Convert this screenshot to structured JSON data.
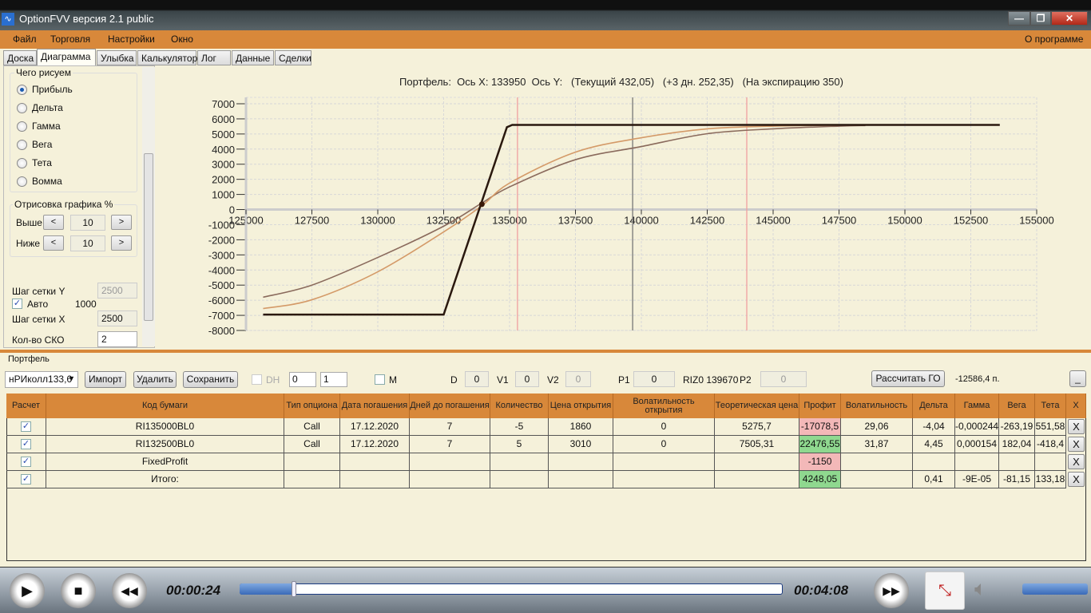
{
  "window": {
    "title": "OptionFVV версия 2.1 public",
    "minimize": "—",
    "restore": "❐",
    "close": "✕"
  },
  "menu": {
    "items": [
      "Файл",
      "Торговля",
      "Настройки",
      "Окно"
    ],
    "about": "О программе"
  },
  "tabs": [
    "Доска",
    "Диаграмма",
    "Улыбка",
    "Калькулятор",
    "Лог",
    "Данные",
    "Сделки"
  ],
  "active_tab": "Диаграмма",
  "left_panel": {
    "draw_group": "Чего рисуем",
    "options": [
      "Прибыль",
      "Дельта",
      "Гамма",
      "Вега",
      "Тета",
      "Вомма"
    ],
    "selected": "Прибыль",
    "render_group": "Отрисовка графика %",
    "above_label": "Выше",
    "above_value": "10",
    "below_label": "Ниже",
    "below_value": "10",
    "prev": "<",
    "next": ">",
    "grid_y_label": "Шаг сетки Y",
    "grid_y_value": "2500",
    "auto_label": "Авто",
    "auto_checked": true,
    "auto_value": "1000",
    "grid_x_label": "Шаг сетки X",
    "grid_x_value": "2500",
    "sko_label": "Кол-во СКО",
    "sko_value": "2"
  },
  "chart_header": "Портфель:  Ось X: 133950  Ось Y:   (Текущий 432,05)   (+3 дн. 252,35)   (На экспирацию 350)",
  "chart_data": {
    "type": "line",
    "xlim": [
      125000,
      155000
    ],
    "ylim": [
      -8000,
      7000
    ],
    "x_ticks": [
      125000,
      127500,
      130000,
      132500,
      135000,
      137500,
      140000,
      142500,
      145000,
      147500,
      150000,
      152500,
      155000
    ],
    "y_ticks": [
      7000,
      6000,
      5000,
      4000,
      3000,
      2000,
      1000,
      0,
      -1000,
      -2000,
      -3000,
      -4000,
      -5000,
      -6000,
      -7000,
      -8000
    ],
    "grid": true,
    "series": [
      {
        "color": "#8a6a5c",
        "x": [
          125650,
          127500,
          130000,
          132500,
          133950,
          135000,
          137500,
          140000,
          142500,
          145000,
          147500,
          148500
        ],
        "y": [
          -5800,
          -5000,
          -3170,
          -1100,
          432,
          1500,
          3300,
          4170,
          5020,
          5340,
          5520,
          5560
        ]
      },
      {
        "color": "#d49a68",
        "x": [
          125650,
          127500,
          130000,
          132500,
          133950,
          135000,
          137500,
          140000,
          142500,
          145000,
          147500,
          148500
        ],
        "y": [
          -6550,
          -5970,
          -4120,
          -1480,
          252,
          1750,
          3800,
          4750,
          5340,
          5520,
          5580,
          5590
        ]
      },
      {
        "color": "#2a180e",
        "x": [
          125650,
          132500,
          134900,
          135100,
          153600
        ],
        "y": [
          -6950,
          -6950,
          5450,
          5600,
          5600
        ]
      }
    ],
    "marker": {
      "x": 133950,
      "y": 350
    },
    "vlines": [
      {
        "x": 135300,
        "color": "#f0a0a0"
      },
      {
        "x": 139670,
        "color": "#777777"
      },
      {
        "x": 144000,
        "color": "#f0a0a0"
      }
    ]
  },
  "portfolio": {
    "label": "Портфель",
    "selector": "нРИколл133,6",
    "import": "Импорт",
    "delete": "Удалить",
    "save": "Сохранить",
    "dh_label": "DH",
    "spin1": "0",
    "spin2": "1",
    "m_label": "M",
    "d_label": "D",
    "d_value": "0",
    "v1_label": "V1",
    "v1_value": "0",
    "v2_label": "V2",
    "v2_value": "0",
    "p1_label": "P1",
    "p1_value": "0",
    "riz": "RIZ0 139670",
    "p2_label": "P2",
    "p2_value": "0",
    "calc_go": "Рассчитать ГО",
    "go_value": "-12586,4 п.",
    "minimize": "_"
  },
  "table": {
    "columns": [
      "Расчет",
      "Код бумаги",
      "Тип опциона",
      "Дата погашения",
      "Дней до погашения",
      "Количество",
      "Цена открытия",
      "Волатильность открытия",
      "Теоретическая цена",
      "Профит",
      "Волатильность",
      "Дельта",
      "Гамма",
      "Вега",
      "Тета",
      "X"
    ],
    "rows": [
      [
        "",
        "RI135000BL0",
        "Call",
        "17.12.2020",
        "7",
        "-5",
        "1860",
        "0",
        "5275,7",
        "-17078,5",
        "29,06",
        "-4,04",
        "-0,000244",
        "-263,19",
        "551,58"
      ],
      [
        "",
        "RI132500BL0",
        "Call",
        "17.12.2020",
        "7",
        "5",
        "3010",
        "0",
        "7505,31",
        "22476,55",
        "31,87",
        "4,45",
        "0,000154",
        "182,04",
        "-418,4"
      ],
      [
        "",
        "FixedProfit",
        "",
        "",
        "",
        "",
        "",
        "",
        "",
        "-1150",
        "",
        "",
        "",
        "",
        ""
      ],
      [
        "",
        "Итого:",
        "",
        "",
        "",
        "",
        "",
        "",
        "",
        "4248,05",
        "",
        "0,41",
        "-9E-05",
        "-81,15",
        "133,18"
      ]
    ],
    "profit_colors": [
      "red",
      "green",
      "red",
      "green"
    ],
    "delete_label": "X",
    "check": "✓"
  },
  "player": {
    "elapsed": "00:00:24",
    "total": "00:04:08",
    "progress": 0.1,
    "volume": 0.98,
    "play": "▶",
    "stop": "■",
    "rewind": "◀◀",
    "forward": "▶▶"
  }
}
